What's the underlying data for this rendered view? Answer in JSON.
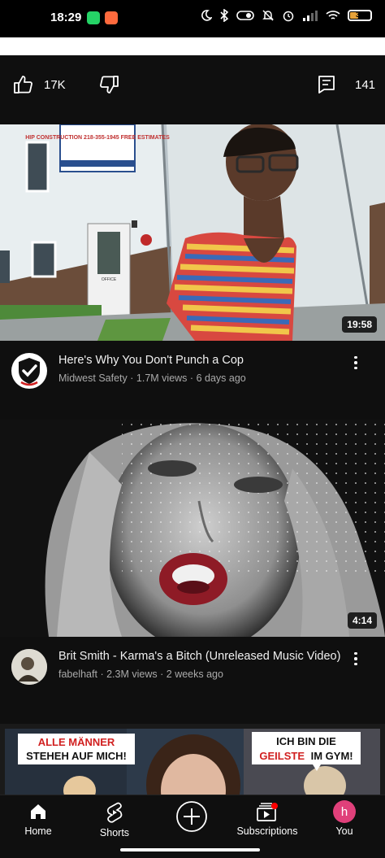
{
  "status": {
    "time": "18:29",
    "battery": "32"
  },
  "actions": {
    "likes": "17K",
    "comments": "141"
  },
  "videos": [
    {
      "title": "Here's Why You Don't Punch a Cop",
      "channel": "Midwest Safety",
      "views": "1.7M views",
      "age": "6 days ago",
      "duration": "19:58",
      "sign_text": "HIP CONSTRUCTION 218-355-1945 FREE ESTIMATES",
      "door_label": "OFFICE"
    },
    {
      "title": "Brit Smith - Karma's a Bitch (Unreleased Music Video)",
      "channel": "fabelhaft",
      "views": "2.3M views",
      "age": "2 weeks ago",
      "duration": "4:14"
    },
    {
      "thumb_text_left_1": "ALLE MÄNNER",
      "thumb_text_left_2": "STEHEH AUF MICH!",
      "thumb_text_right_1": "ICH BIN DIE",
      "thumb_text_right_2": "GEILSTE",
      "thumb_text_right_3": "IM GYM!"
    }
  ],
  "meta_separator": "·",
  "nav": {
    "home": "Home",
    "shorts": "Shorts",
    "subscriptions": "Subscriptions",
    "you": "You",
    "avatar_letter": "h"
  },
  "colors": {
    "background": "#0f0f0f",
    "avatar_pink": "#e0407a",
    "notification": "#ff0000"
  }
}
